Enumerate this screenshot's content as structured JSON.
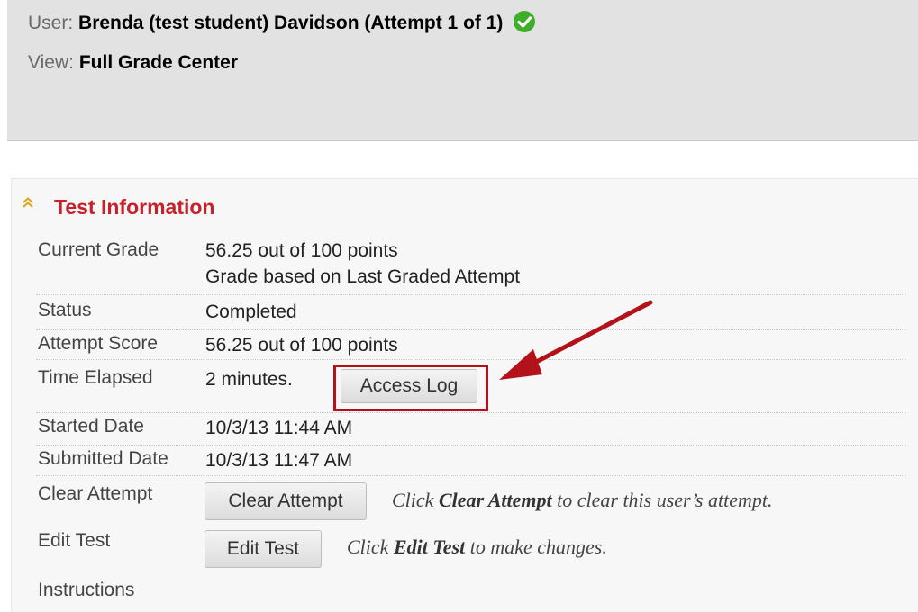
{
  "header": {
    "user_label": "User:",
    "user_value": "Brenda (test student) Davidson (Attempt 1 of 1)",
    "user_status_icon": "check-circle-icon",
    "view_label": "View:",
    "view_value": "Full Grade Center"
  },
  "section": {
    "title": "Test Information",
    "collapse_icon": "double-chevron-up-icon",
    "accent_color": "#c7212b"
  },
  "rows": {
    "current_grade": {
      "label": "Current Grade",
      "value": "56.25 out of 100 points",
      "note": "Grade based on Last Graded Attempt"
    },
    "status": {
      "label": "Status",
      "value": "Completed"
    },
    "attempt_score": {
      "label": "Attempt Score",
      "value": "56.25 out of 100 points"
    },
    "time_elapsed": {
      "label": "Time Elapsed",
      "value": "2 minutes.",
      "button": "Access Log"
    },
    "started_date": {
      "label": "Started Date",
      "value": "10/3/13 11:44 AM"
    },
    "submitted_date": {
      "label": "Submitted Date",
      "value": "10/3/13 11:47 AM"
    },
    "clear_attempt": {
      "label": "Clear Attempt",
      "button": "Clear Attempt",
      "hint_pre": "Click ",
      "hint_bold": "Clear Attempt",
      "hint_post": " to clear this user’s attempt."
    },
    "edit_test": {
      "label": "Edit Test",
      "button": "Edit Test",
      "hint_pre": "Click ",
      "hint_bold": "Edit Test",
      "hint_post": " to make changes."
    },
    "instructions": {
      "label": "Instructions"
    }
  },
  "annotation": {
    "color": "#b3121b",
    "arrow_icon": "red-arrow-icon"
  }
}
